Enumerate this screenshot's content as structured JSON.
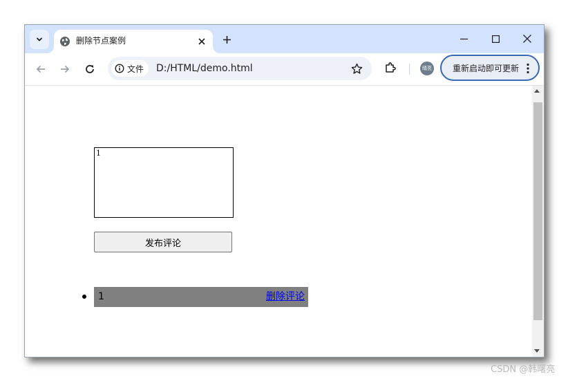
{
  "tab": {
    "title": "删除节点案例",
    "close_icon": "close-icon",
    "favicon": "globe-icon"
  },
  "address_bar": {
    "security_chip": "文件",
    "url": "D:/HTML/demo.html"
  },
  "profile": {
    "avatar_text": "晴亮"
  },
  "update_button": {
    "label": "重新启动即可更新"
  },
  "page": {
    "textarea_value": "1",
    "publish_button": "发布评论",
    "comments": [
      {
        "text": "1",
        "delete_label": "删除评论"
      }
    ]
  },
  "watermark": "CSDN @韩曙亮",
  "colors": {
    "tabstrip": "#d3e3fd",
    "comment_bg": "#808080",
    "link": "#0000ee",
    "update_border": "#3867b4"
  }
}
